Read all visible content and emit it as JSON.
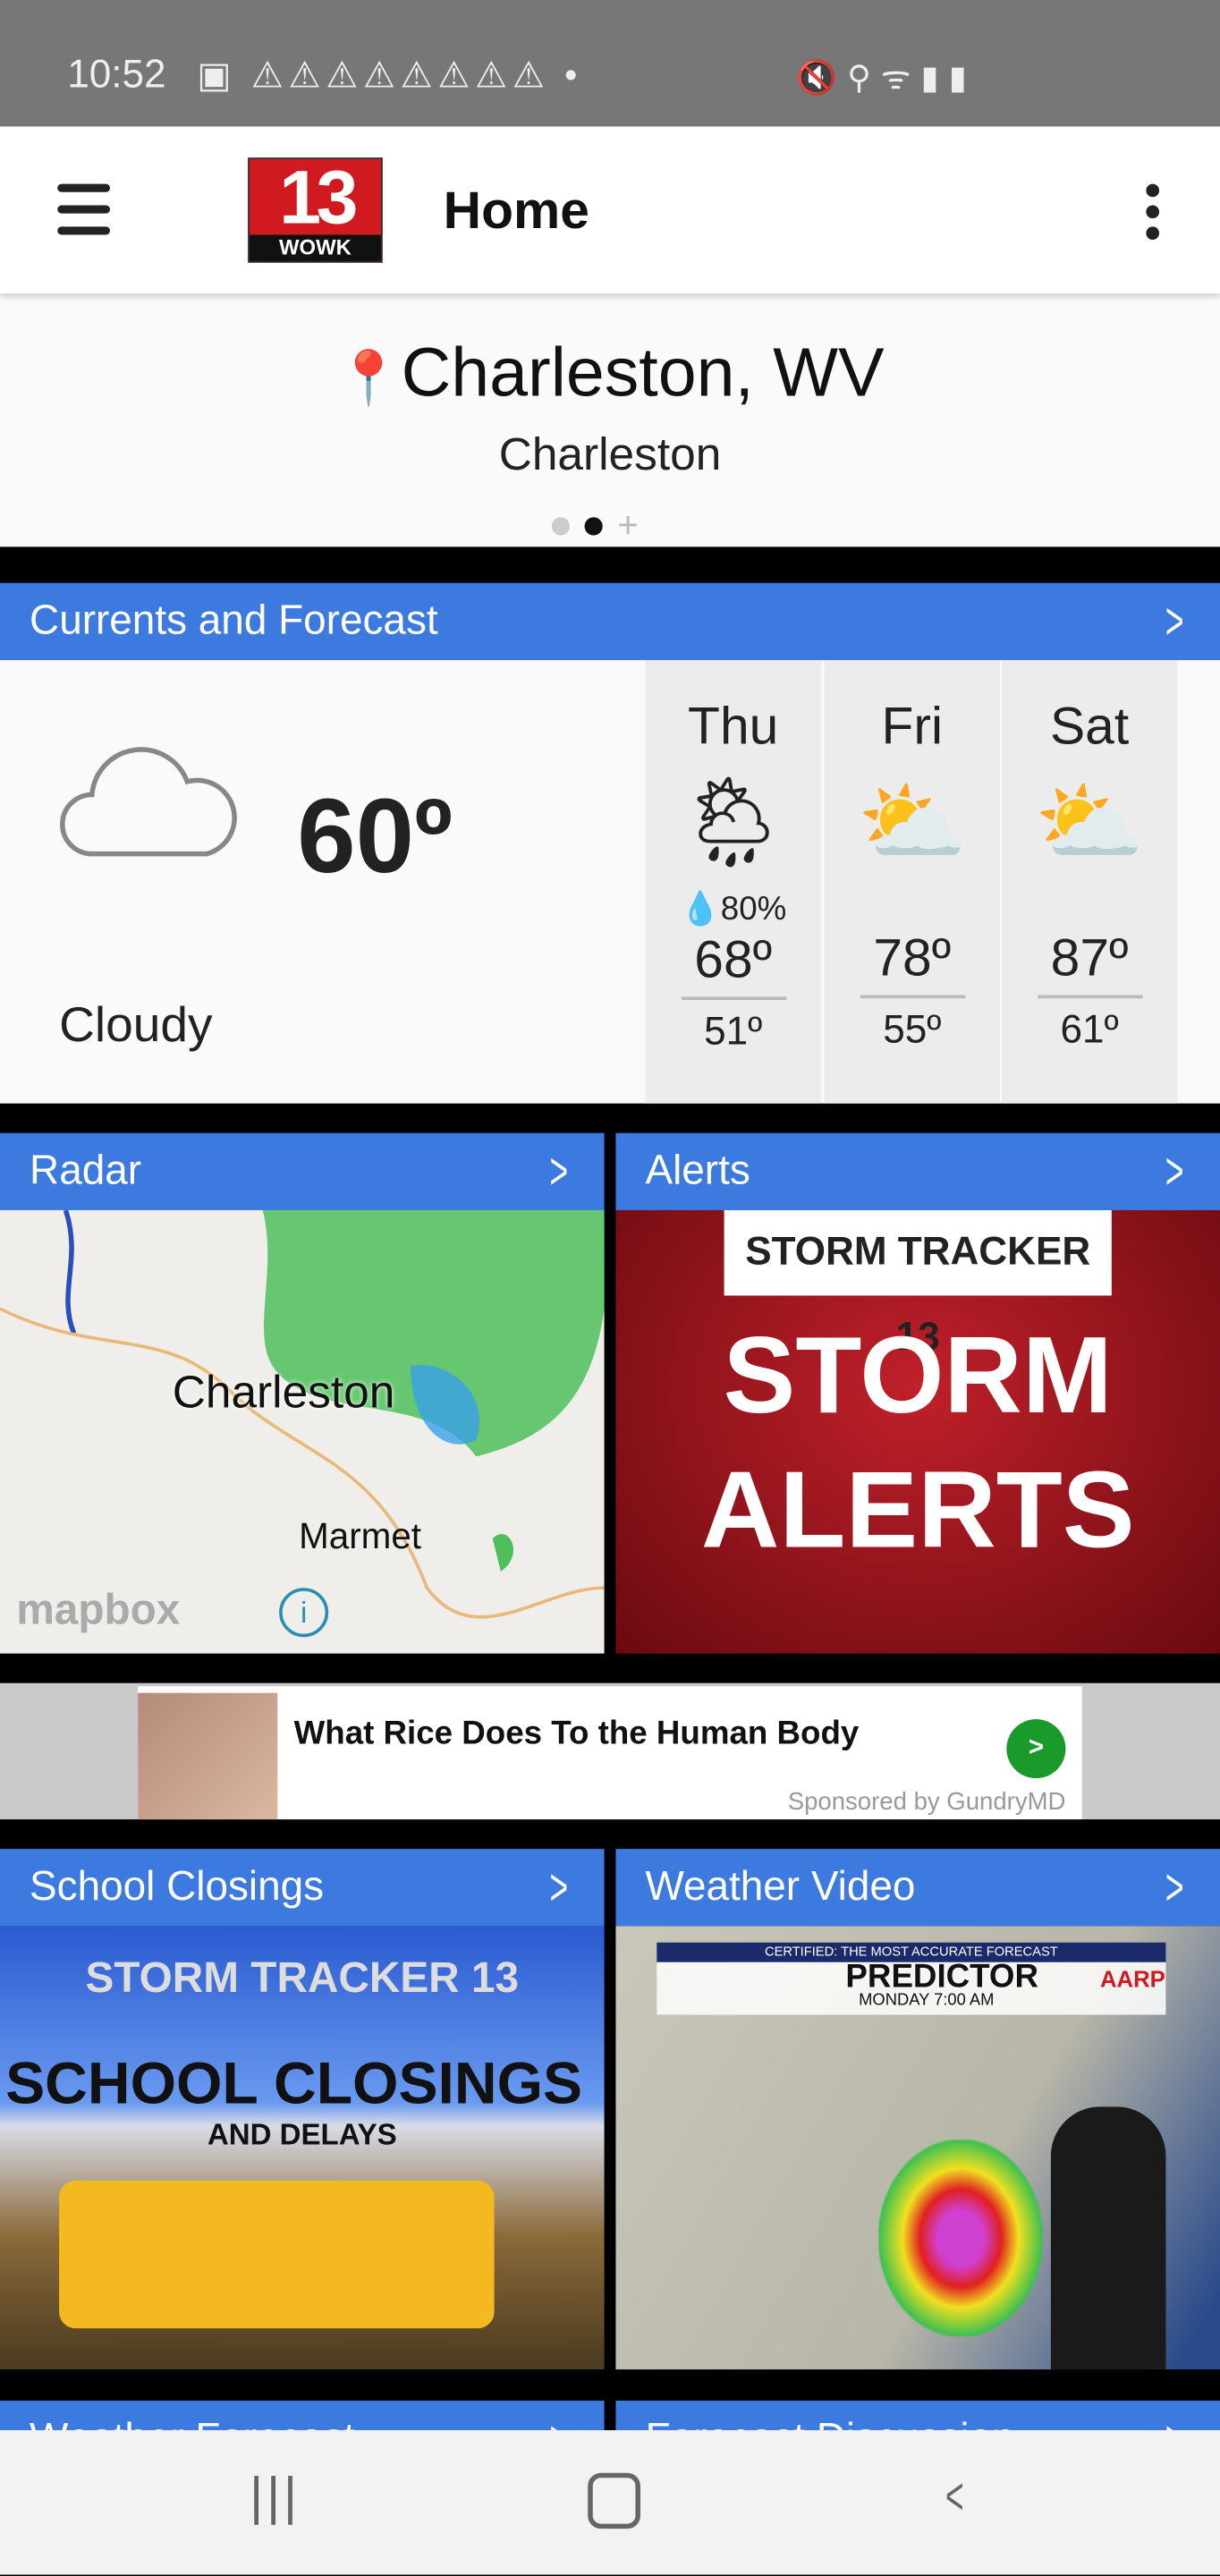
{
  "status_bar": {
    "time": "10:52",
    "warning_count": 8,
    "icons": [
      "teams-icon",
      "warning-icon",
      "dot",
      "mute-icon",
      "location-icon",
      "wifi-icon",
      "signal-icon",
      "battery-icon"
    ]
  },
  "app_bar": {
    "logo_text": "13 WOWK",
    "title": "Home"
  },
  "location": {
    "name": "Charleston, WV",
    "subtitle": "Charleston",
    "pages": 3,
    "active_page": 2
  },
  "currents": {
    "header": "Currents and Forecast",
    "temp": "60º",
    "condition": "Cloudy",
    "icon": "cloud-icon",
    "forecast": [
      {
        "day": "Thu",
        "icon": "partly-sunny-rain-icon",
        "precip": "80%",
        "high": "68º",
        "low": "51º"
      },
      {
        "day": "Fri",
        "icon": "partly-sunny-icon",
        "high": "78º",
        "low": "55º"
      },
      {
        "day": "Sat",
        "icon": "partly-sunny-icon",
        "high": "87º",
        "low": "61º"
      }
    ]
  },
  "tiles": {
    "radar": {
      "label": "Radar",
      "map_labels": [
        "Charleston",
        "Marmet"
      ],
      "attribution": "mapbox"
    },
    "alerts": {
      "label": "Alerts",
      "brand": "STORM TRACKER 13",
      "line1": "STORM",
      "line2": "ALERTS"
    },
    "school": {
      "label": "School Closings",
      "brand": "STORM TRACKER 13",
      "line1": "SCHOOL CLOSINGS",
      "line2": "AND DELAYS"
    },
    "video": {
      "label": "Weather Video",
      "banner": "CERTIFIED: THE MOST ACCURATE FORECAST",
      "heading": "PREDICTOR",
      "time": "MONDAY 7:00 AM",
      "sponsor": "AARP"
    },
    "partial_left": {
      "label": "Weather Forecast"
    },
    "partial_right": {
      "label": "Forecast Discussion"
    }
  },
  "ad": {
    "headline": "What Rice Does To the Human Body",
    "sponsor": "Sponsored by GundryMD"
  },
  "colors": {
    "header_blue": "#3d7ae0",
    "status_gray": "#777777",
    "ad_green": "#1a9a2a"
  }
}
